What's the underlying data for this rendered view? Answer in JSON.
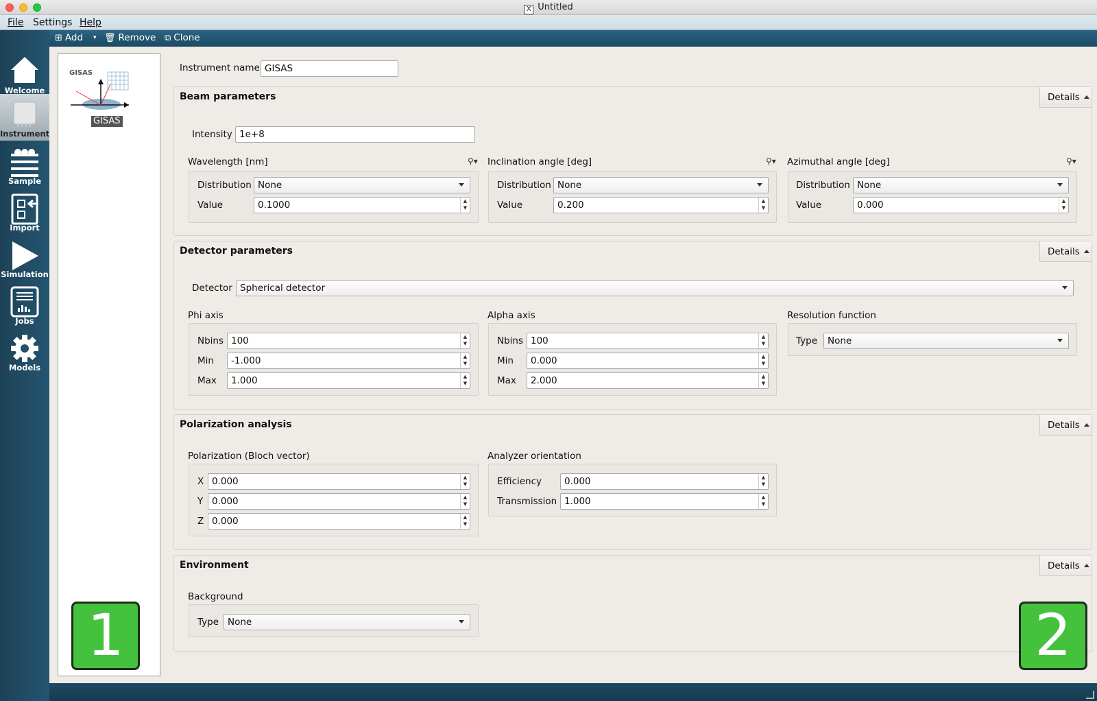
{
  "window": {
    "title": "Untitled",
    "x_icon": "X"
  },
  "menubar": {
    "items": [
      "File",
      "Settings",
      "Help"
    ]
  },
  "toolbar": {
    "add": "Add",
    "remove": "Remove",
    "clone": "Clone"
  },
  "sidebar": {
    "items": [
      {
        "label": "Welcome",
        "icon": "home-icon"
      },
      {
        "label": "Instrument",
        "icon": "chip-icon",
        "selected": true
      },
      {
        "label": "Sample",
        "icon": "layers-icon"
      },
      {
        "label": "Import",
        "icon": "import-icon"
      },
      {
        "label": "Simulation",
        "icon": "play-icon"
      },
      {
        "label": "Jobs",
        "icon": "jobs-icon"
      },
      {
        "label": "Models",
        "icon": "gear-icon"
      }
    ]
  },
  "instrument_list": {
    "items": [
      {
        "name": "GISAS",
        "thumbnail_label": "GISAS"
      }
    ]
  },
  "instrument": {
    "name_label": "Instrument name",
    "name_value": "GISAS"
  },
  "beam": {
    "title": "Beam parameters",
    "details": "Details",
    "intensity_label": "Intensity",
    "intensity_value": "1e+8",
    "wavelength": {
      "title": "Wavelength [nm]",
      "dist_label": "Distribution",
      "dist_value": "None",
      "value_label": "Value",
      "value": "0.1000"
    },
    "inclination": {
      "title": "Inclination angle [deg]",
      "dist_label": "Distribution",
      "dist_value": "None",
      "value_label": "Value",
      "value": "0.200"
    },
    "azimuthal": {
      "title": "Azimuthal angle [deg]",
      "dist_label": "Distribution",
      "dist_value": "None",
      "value_label": "Value",
      "value": "0.000"
    }
  },
  "detector": {
    "title": "Detector parameters",
    "details": "Details",
    "detector_label": "Detector",
    "detector_value": "Spherical detector",
    "phi": {
      "title": "Phi axis",
      "nbins_label": "Nbins",
      "nbins": "100",
      "min_label": "Min",
      "min": "-1.000",
      "max_label": "Max",
      "max": "1.000"
    },
    "alpha": {
      "title": "Alpha axis",
      "nbins_label": "Nbins",
      "nbins": "100",
      "min_label": "Min",
      "min": "0.000",
      "max_label": "Max",
      "max": "2.000"
    },
    "resolution": {
      "title": "Resolution function",
      "type_label": "Type",
      "type_value": "None"
    }
  },
  "polarization": {
    "title": "Polarization analysis",
    "details": "Details",
    "bloch": {
      "title": "Polarization (Bloch vector)",
      "x_label": "X",
      "x": "0.000",
      "y_label": "Y",
      "y": "0.000",
      "z_label": "Z",
      "z": "0.000"
    },
    "analyzer": {
      "title": "Analyzer orientation",
      "eff_label": "Efficiency",
      "eff": "0.000",
      "trans_label": "Transmission",
      "trans": "1.000"
    }
  },
  "environment": {
    "title": "Environment",
    "details": "Details",
    "background": {
      "title": "Background",
      "type_label": "Type",
      "type_value": "None"
    }
  },
  "badges": {
    "left": "1",
    "right": "2"
  },
  "colors": {
    "sidebar": "#1d4257",
    "toolbar": "#2a6483",
    "badge": "#44c23d"
  }
}
